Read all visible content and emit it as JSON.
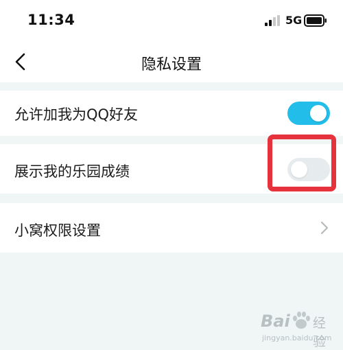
{
  "status_bar": {
    "time": "11:34",
    "network": "5G",
    "signal_icon": "signal-bars-icon",
    "battery_icon": "battery-icon"
  },
  "header": {
    "back_icon": "chevron-left-icon",
    "title": "隐私设置"
  },
  "settings": [
    {
      "label": "允许加我为QQ好友",
      "control": "toggle",
      "state": "on"
    },
    {
      "label": "展示我的乐园成绩",
      "control": "toggle",
      "state": "off"
    },
    {
      "label": "小窝权限设置",
      "control": "chevron",
      "icon": "chevron-right-icon"
    }
  ],
  "annotation": {
    "type": "highlight-box",
    "color": "#e5323c"
  },
  "watermark": {
    "brand_prefix": "Bai",
    "brand_suffix": "经验",
    "url": "jingyan.baidu.com"
  },
  "colors": {
    "toggle_on": "#22bde8",
    "toggle_off": "#e6ecee",
    "background": "#f0f6f6",
    "highlight": "#e5323c"
  }
}
